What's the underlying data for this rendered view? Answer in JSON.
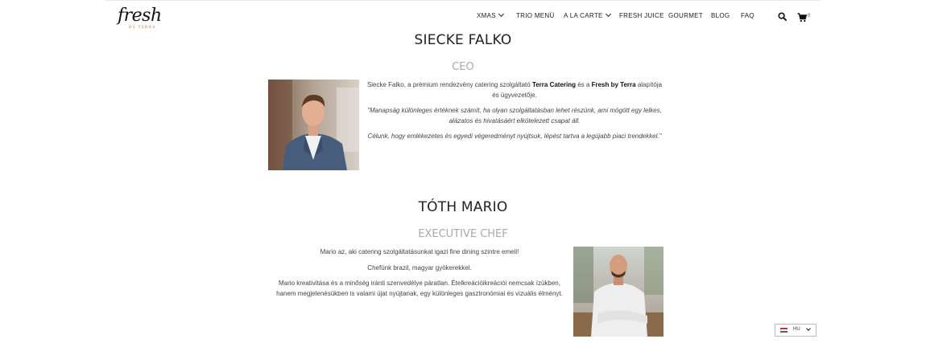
{
  "brand": {
    "logo_script": "fresh",
    "logo_sub": "BY TERRA"
  },
  "nav": {
    "items": [
      {
        "label": "XMAS",
        "has_dropdown": true
      },
      {
        "label": "TRIO MENÜ",
        "has_dropdown": false
      },
      {
        "label": "A LA CARTE",
        "has_dropdown": true
      },
      {
        "label": "FRESH JUICE",
        "has_dropdown": false
      },
      {
        "label": "GOURMET",
        "has_dropdown": false
      },
      {
        "label": "BLOG",
        "has_dropdown": false
      },
      {
        "label": "FAQ",
        "has_dropdown": false
      }
    ],
    "search_icon": "search-icon",
    "cart_icon": "shopping-cart-icon",
    "cart_count": "0"
  },
  "person1": {
    "name": "SIECKE FALKO",
    "role": "CEO",
    "intro_a": "Siecke Falko, a prémium rendezvény catering szolgáltató ",
    "intro_b1": "Terra Catering",
    "intro_c": " és a ",
    "intro_b2": "Fresh by Terra",
    "intro_d": " alapítója és ügyvezetője.",
    "quote1": "\"Manapság különleges értéknek számít, ha olyan szolgáltatásban lehet részünk, ami mögött egy lelkes, alázatos és hivatásáért elkötelezett csapat áll.",
    "quote2": "Célunk, hogy emlékezetes és egyedi végeredményt nyújtsuk, lépést tartva a legújabb piaci trendekkel.\""
  },
  "person2": {
    "name": "TÓTH MARIO",
    "role": "EXECUTIVE CHEF",
    "p1": "Mario az, aki catering szolgáltatásunkat igazi fine dining szintre emeli!",
    "p2": "Chefünk brazil, magyar gyökerekkel.",
    "p3": "Mario kreativitása és a minőség iránti szenvedélye páratlan. Ételkreációikreációi nemcsak ízükben, hanem megjelenésükben is valami újat nyújtanak, egy különleges gasztronómiai és vizuális élményt."
  },
  "language": {
    "current": "HU",
    "flag_colors": [
      "#cd2a3e",
      "#ffffff",
      "#436f4d"
    ]
  }
}
